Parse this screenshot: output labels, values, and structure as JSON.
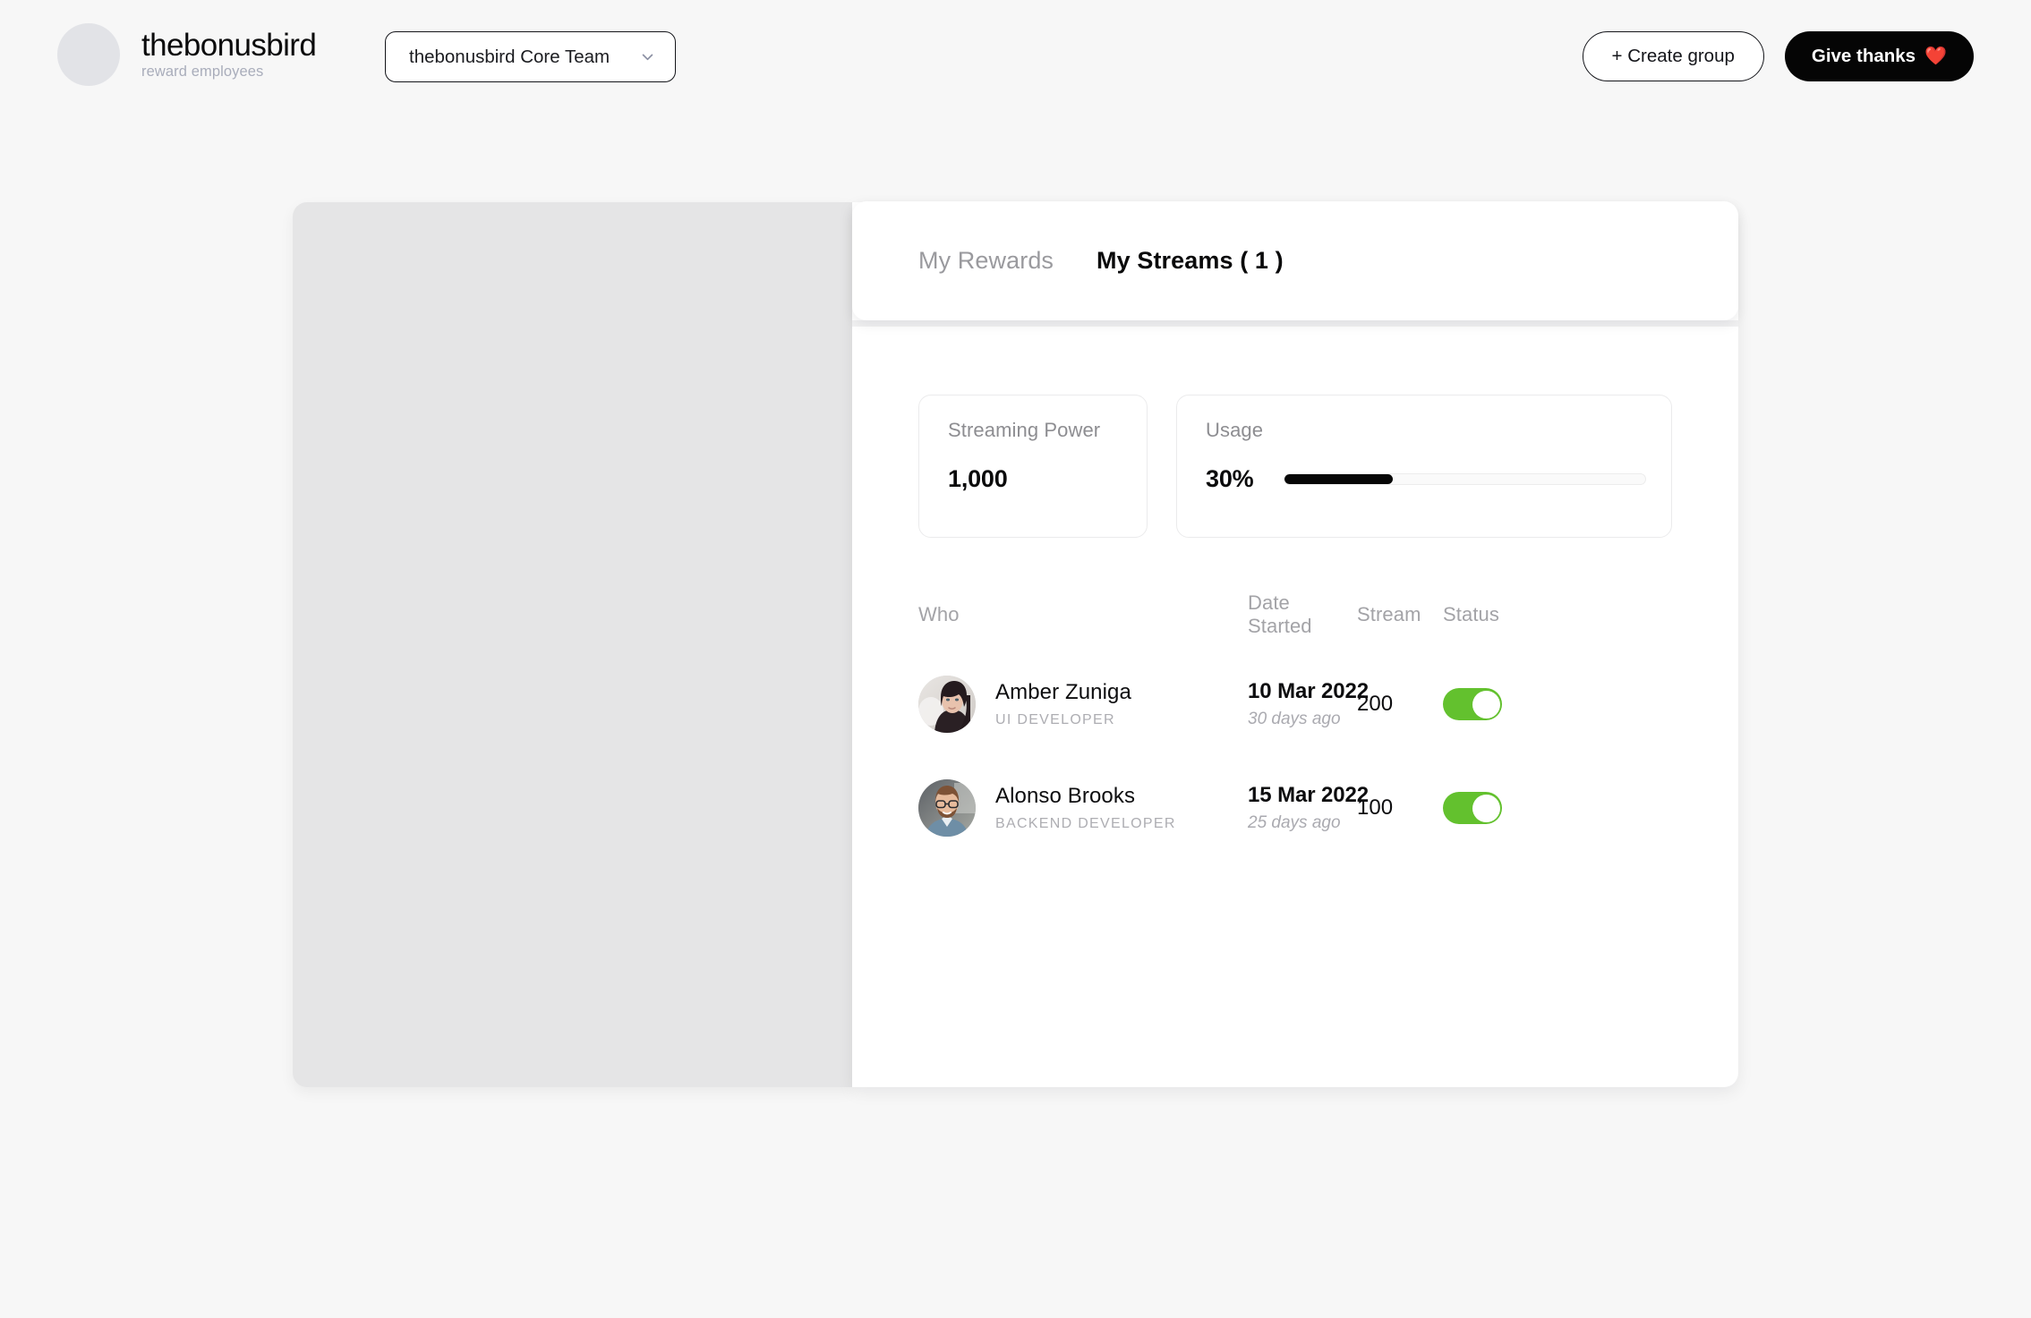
{
  "brand": {
    "name": "thebonusbird",
    "tagline": "reward employees",
    "avatar_icon": "user-avatar-placeholder"
  },
  "topbar": {
    "team_selector": {
      "value": "thebonusbird Core Team",
      "icon": "chevron-down-icon"
    },
    "create_group_label": "+ Create group",
    "give_thanks_label": "Give thanks",
    "give_thanks_icon": "heart-icon",
    "give_thanks_emoji": "❤️"
  },
  "tabs": [
    {
      "label": "My Rewards",
      "active": false
    },
    {
      "label": "My Streams ( 1 )",
      "active": true
    }
  ],
  "stats": {
    "streaming_power": {
      "label": "Streaming Power",
      "value": "1,000"
    },
    "usage": {
      "label": "Usage",
      "value": "30%",
      "percent": 30
    }
  },
  "table": {
    "headers": {
      "who": "Who",
      "date": "Date Started",
      "stream": "Stream",
      "status": "Status"
    },
    "rows": [
      {
        "name": "Amber Zuniga",
        "role": "UI DEVELOPER",
        "date": "10 Mar 2022",
        "relative": "30 days ago",
        "stream": "200",
        "status_on": true,
        "avatar_icon": "avatar-amber-zuniga"
      },
      {
        "name": "Alonso Brooks",
        "role": "BACKEND DEVELOPER",
        "date": "15 Mar 2022",
        "relative": "25 days ago",
        "stream": "100",
        "status_on": true,
        "avatar_icon": "avatar-alonso-brooks"
      }
    ]
  },
  "colors": {
    "page_background": "#f7f7f7",
    "left_panel": "#e5e5e6",
    "accent_dark": "#050505",
    "toggle_on": "#63c12e",
    "muted_text": "#a3a3a7"
  }
}
